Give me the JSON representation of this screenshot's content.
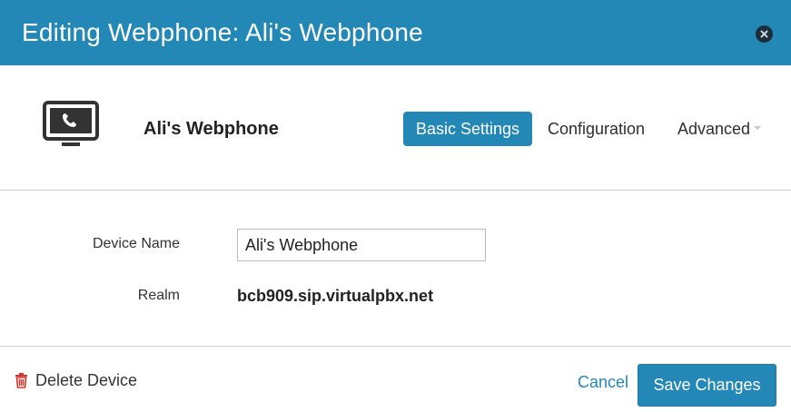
{
  "dialog": {
    "title": "Editing Webphone: Ali's Webphone"
  },
  "device": {
    "name": "Ali's Webphone",
    "icon": "webphone-monitor-icon"
  },
  "tabs": [
    {
      "label": "Basic Settings",
      "active": true
    },
    {
      "label": "Configuration",
      "active": false
    },
    {
      "label": "Advanced",
      "active": false
    }
  ],
  "form": {
    "device_name_label": "Device Name",
    "device_name_value": "Ali's Webphone",
    "realm_label": "Realm",
    "realm_value": "bcb909.sip.virtualpbx.net"
  },
  "footer": {
    "delete_label": "Delete Device",
    "cancel_label": "Cancel",
    "save_label": "Save Changes"
  },
  "colors": {
    "accent": "#2488b7",
    "delete_icon": "#d9342b"
  }
}
